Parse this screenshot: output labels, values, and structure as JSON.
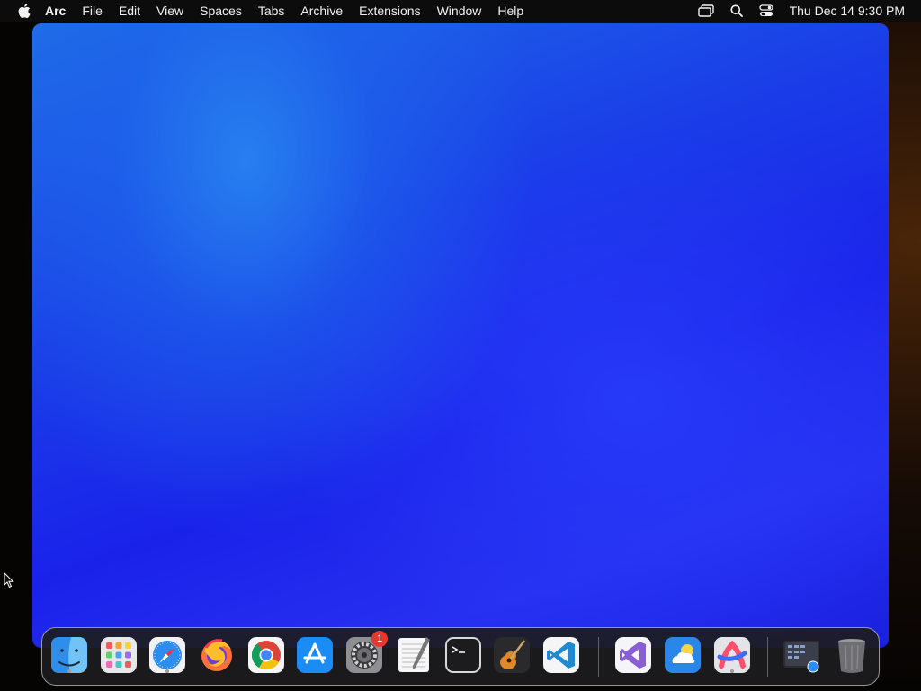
{
  "menubar": {
    "app_name": "Arc",
    "menus": [
      "File",
      "Edit",
      "View",
      "Spaces",
      "Tabs",
      "Archive",
      "Extensions",
      "Window",
      "Help"
    ],
    "clock": "Thu Dec 14  9:30 PM"
  },
  "dock": {
    "apps": [
      {
        "name": "Finder",
        "icon": "finder-icon",
        "running": true
      },
      {
        "name": "Launchpad",
        "icon": "launchpad-icon",
        "running": false
      },
      {
        "name": "Safari",
        "icon": "safari-icon",
        "running": true
      },
      {
        "name": "Firefox",
        "icon": "firefox-icon",
        "running": false
      },
      {
        "name": "Google Chrome",
        "icon": "chrome-icon",
        "running": false
      },
      {
        "name": "App Store",
        "icon": "app-store-icon",
        "running": false
      },
      {
        "name": "System Settings",
        "icon": "system-settings-icon",
        "running": false,
        "badge": "1"
      },
      {
        "name": "TextEdit",
        "icon": "textedit-icon",
        "running": false
      },
      {
        "name": "Terminal",
        "icon": "terminal-icon",
        "running": false
      },
      {
        "name": "GarageBand",
        "icon": "garageband-icon",
        "running": false
      },
      {
        "name": "Visual Studio Code",
        "icon": "vscode-icon",
        "running": false
      },
      {
        "name": "Visual Studio",
        "icon": "visual-studio-icon",
        "running": false
      },
      {
        "name": "Weather",
        "icon": "weather-icon",
        "running": false
      },
      {
        "name": "Arc",
        "icon": "arc-icon",
        "running": true
      }
    ],
    "utility": [
      {
        "name": "Screenshots",
        "icon": "screenshot-folder-icon"
      },
      {
        "name": "Trash",
        "icon": "trash-icon"
      }
    ]
  },
  "colors": {
    "window_gradient_light": "#2a85f0",
    "window_gradient_dark": "#1a20e8",
    "menubar": "#0d0c0c"
  }
}
